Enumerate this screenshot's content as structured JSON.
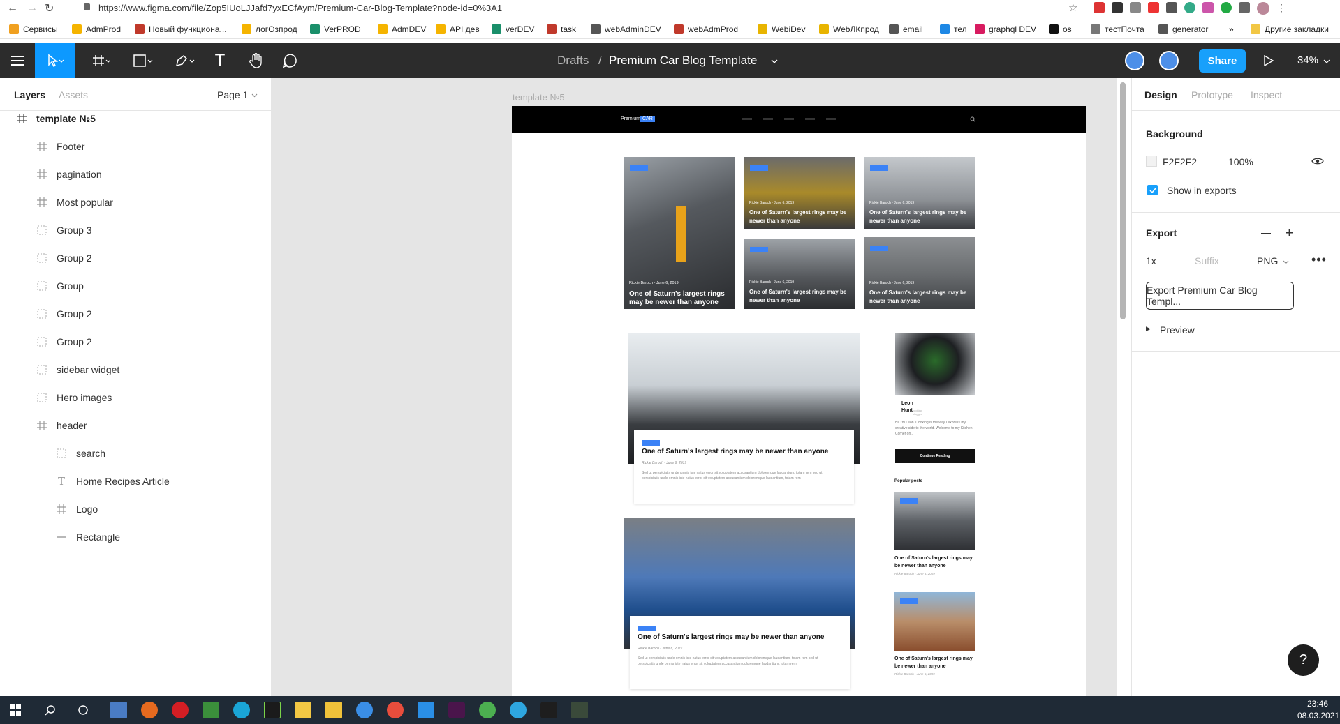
{
  "browser": {
    "url": "https://www.figma.com/file/Zop5IUoLJJafd7yxECfAym/Premium-Car-Blog-Template?node-id=0%3A1",
    "bookmarks": [
      "Сервисы",
      "AdmProd",
      "Новый функциона...",
      "логОзпрод",
      "VerPROD",
      "AdmDEV",
      "API дев",
      "verDEV",
      "task",
      "webAdminDEV",
      "webAdmProd",
      "WebiDev",
      "WebЛКпрод",
      "email",
      "тел",
      "graphql DEV",
      "os",
      "тестПочта",
      "generator"
    ],
    "more_label": "»",
    "other_bookmarks": "Другие закладки"
  },
  "toolbar": {
    "breadcrumb_drafts": "Drafts",
    "breadcrumb_sep": "/",
    "file_title": "Premium Car Blog Template",
    "share_label": "Share",
    "zoom": "34%"
  },
  "left_panel": {
    "tab_layers": "Layers",
    "tab_assets": "Assets",
    "page_label": "Page 1",
    "layers": [
      {
        "name": "template №5",
        "type": "frame",
        "level": 0
      },
      {
        "name": "Footer",
        "type": "frame",
        "level": 1
      },
      {
        "name": "pagination",
        "type": "frame",
        "level": 1
      },
      {
        "name": "Most popular",
        "type": "frame",
        "level": 1
      },
      {
        "name": "Group 3",
        "type": "group",
        "level": 1
      },
      {
        "name": "Group 2",
        "type": "group",
        "level": 1
      },
      {
        "name": "Group",
        "type": "group",
        "level": 1
      },
      {
        "name": "Group 2",
        "type": "group",
        "level": 1
      },
      {
        "name": "Group 2",
        "type": "group",
        "level": 1
      },
      {
        "name": "sidebar widget",
        "type": "group",
        "level": 1
      },
      {
        "name": "Hero images",
        "type": "group",
        "level": 1
      },
      {
        "name": "header",
        "type": "frame",
        "level": 1
      },
      {
        "name": "search",
        "type": "group",
        "level": 2
      },
      {
        "name": "Home Recipes Article",
        "type": "text",
        "level": 2
      },
      {
        "name": "Logo",
        "type": "frame",
        "level": 2
      },
      {
        "name": "Rectangle",
        "type": "line",
        "level": 2
      }
    ]
  },
  "canvas": {
    "frame_label": "template №5",
    "logo_text": "Premium",
    "logo_badge": "CAR",
    "hero_meta": "Rickie Baroch - June 6, 2019",
    "hero_title": "One of Saturn's largest rings may be newer than anyone",
    "article_meta": "Rickie Baroch - June 6, 2019",
    "article_title": "One of Saturn's largest rings may be newer than anyone",
    "article_excerpt": "Sed ut perspiciatis unde omnis iste natus error sit voluptatem accusantium doloremque laudantium, totam rem sed ut perspiciatis unde omnis iste natus error sit voluptatem accusantium doloremque laudantium, totam rem",
    "author_first": "Leon",
    "author_last": "Hunt",
    "author_role": "cooking blogger",
    "author_bio": "Hi, I'm Leon. Cooking is the way I express my creative side to the world. Welcome to my Kitchen Corner on...",
    "continue_label": "Continue Reading",
    "popular_heading": "Popular posts",
    "popular_title": "One of Saturn's largest rings may be newer than anyone",
    "popular_meta": "Rickie Baroch - June 6, 2019"
  },
  "right_panel": {
    "tab_design": "Design",
    "tab_prototype": "Prototype",
    "tab_inspect": "Inspect",
    "background_heading": "Background",
    "bg_hex": "F2F2F2",
    "bg_opacity": "100%",
    "show_in_exports": "Show in exports",
    "export_heading": "Export",
    "export_scale": "1x",
    "export_suffix_placeholder": "Suffix",
    "export_format": "PNG",
    "export_button": "Export Premium Car Blog Templ...",
    "preview_label": "Preview",
    "help_label": "?"
  },
  "taskbar": {
    "time": "23:46",
    "date": "08.03.2021"
  },
  "colors": {
    "figma_toolbar": "#2c2c2c",
    "tool_active": "#0d99ff",
    "share_button": "#18a0fb",
    "canvas_bg": "#e5e5e5",
    "accent_tag": "#3b82f6"
  }
}
